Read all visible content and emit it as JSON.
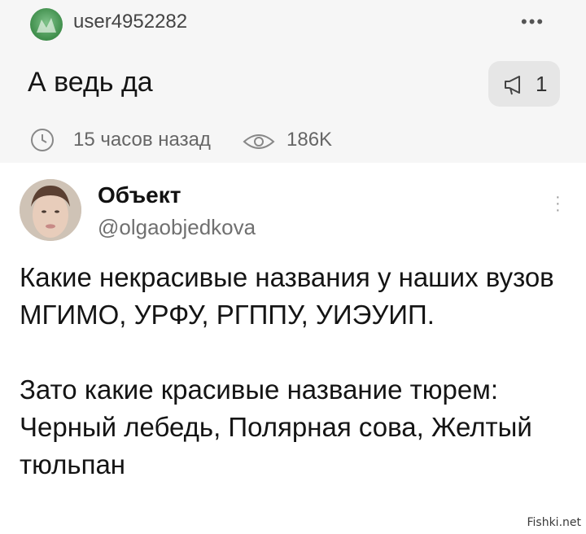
{
  "post": {
    "author": "user4952282",
    "title": "А ведь да",
    "repost_count": "1",
    "time_ago": "15 часов назад",
    "views": "186K",
    "icons": {
      "avatar": "avatar-icon",
      "more": "more-icon",
      "repost": "megaphone-icon",
      "time": "clock-icon",
      "views": "eye-icon"
    }
  },
  "tweet": {
    "author_name": "Объект",
    "handle": "@olgaobjedkova",
    "text": "Какие некрасивые названия у наших вузов МГИМО, УРФУ, РГППУ, УИЭУИП.\n\nЗато какие красивые название тюрем: Черный лебедь, Полярная сова, Желтый тюльпан"
  },
  "watermark": "Fishki.net"
}
